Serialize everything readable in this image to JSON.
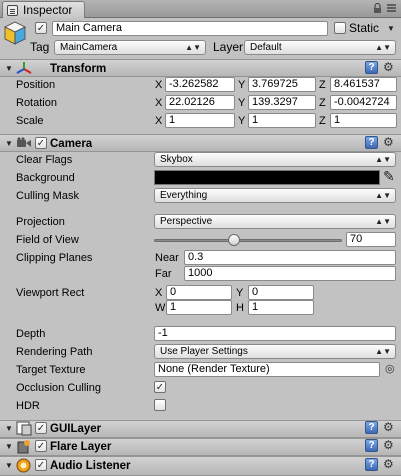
{
  "window": {
    "tab_label": "Inspector",
    "menu_icon": "window-menu-icon",
    "lock_icon": "lock-icon"
  },
  "gameobject": {
    "active": true,
    "name": "Main Camera",
    "static_label": "Static",
    "static_checked": false,
    "tag_label": "Tag",
    "tag_value": "MainCamera",
    "layer_label": "Layer",
    "layer_value": "Default"
  },
  "transform": {
    "title": "Transform",
    "position_label": "Position",
    "rotation_label": "Rotation",
    "scale_label": "Scale",
    "axis_x": "X",
    "axis_y": "Y",
    "axis_z": "Z",
    "position": {
      "x": "-3.262582",
      "y": "3.769725",
      "z": "8.461537"
    },
    "rotation": {
      "x": "22.02126",
      "y": "139.3297",
      "z": "-0.0042724"
    },
    "scale": {
      "x": "1",
      "y": "1",
      "z": "1"
    }
  },
  "camera": {
    "title": "Camera",
    "enabled": true,
    "clear_flags_label": "Clear Flags",
    "clear_flags": "Skybox",
    "background_label": "Background",
    "background_color": "#000000",
    "culling_mask_label": "Culling Mask",
    "culling_mask": "Everything",
    "projection_label": "Projection",
    "projection": "Perspective",
    "fov_label": "Field of View",
    "fov": "70",
    "fov_fraction": 0.425,
    "clipping_label": "Clipping Planes",
    "near_label": "Near",
    "near": "0.3",
    "far_label": "Far",
    "far": "1000",
    "viewport_label": "Viewport Rect",
    "vp_x_label": "X",
    "vp_y_label": "Y",
    "vp_w_label": "W",
    "vp_h_label": "H",
    "vp_x": "0",
    "vp_y": "0",
    "vp_w": "1",
    "vp_h": "1",
    "depth_label": "Depth",
    "depth": "-1",
    "rendering_path_label": "Rendering Path",
    "rendering_path": "Use Player Settings",
    "target_texture_label": "Target Texture",
    "target_texture": "None (Render Texture)",
    "occlusion_label": "Occlusion Culling",
    "occlusion": true,
    "hdr_label": "HDR",
    "hdr": false
  },
  "components": [
    {
      "title": "GUILayer",
      "enabled": true
    },
    {
      "title": "Flare Layer",
      "enabled": true
    },
    {
      "title": "Audio Listener",
      "enabled": true
    }
  ],
  "glyphs": {
    "check": "✓",
    "help": "?",
    "gear": "⚙",
    "collapse": "▼",
    "dropdown": "▲▼",
    "down": "▼",
    "eyedropper": "✎",
    "target": "◎"
  }
}
